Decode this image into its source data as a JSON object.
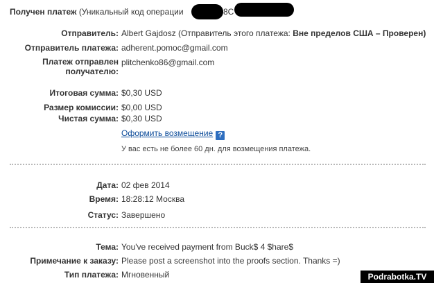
{
  "header": {
    "title": "Получен платеж",
    "subtitle": "(Уникальный код операции",
    "visible_fragment": "8C"
  },
  "details": {
    "sender_label": "Отправитель:",
    "sender_value": "Albert Gajdosz (Отправитель этого платежа:",
    "sender_status": "Вне пределов США – Проверен)",
    "payer_email_label": "Отправитель платежа:",
    "payer_email_value": "adherent.pomoc@gmail.com",
    "sent_to_label": "Платеж отправлен получателю:",
    "sent_to_value": "plitchenko86@gmail.com",
    "total_label": "Итоговая сумма:",
    "total_value": "$0,30 USD",
    "fee_label": "Размер комиссии:",
    "fee_value": "$0,00 USD",
    "net_label": "Чистая сумма:",
    "net_value": "$0,30 USD",
    "refund_link": "Оформить возмещение",
    "help_icon": "?",
    "refund_note": "У вас есть не более 60 дн. для возмещения платежа."
  },
  "status_block": {
    "date_label": "Дата:",
    "date_value": "02 фев 2014",
    "time_label": "Время:",
    "time_value": "18:28:12 Москва",
    "status_label": "Статус:",
    "status_value": "Завершено"
  },
  "message_block": {
    "subject_label": "Тема:",
    "subject_value": "You've received payment from Buck$ 4 $hare$",
    "note_label": "Примечание к заказу:",
    "note_value": "Please post a screenshot into the proofs section. Thanks =)",
    "type_label": "Тип платежа:",
    "type_value": "Мгновенный"
  },
  "watermark": "Podrabotka.TV",
  "colors": {
    "link": "#0d4c9a",
    "help_icon": "#2f6fc0",
    "divider": "#b8b8b8"
  }
}
